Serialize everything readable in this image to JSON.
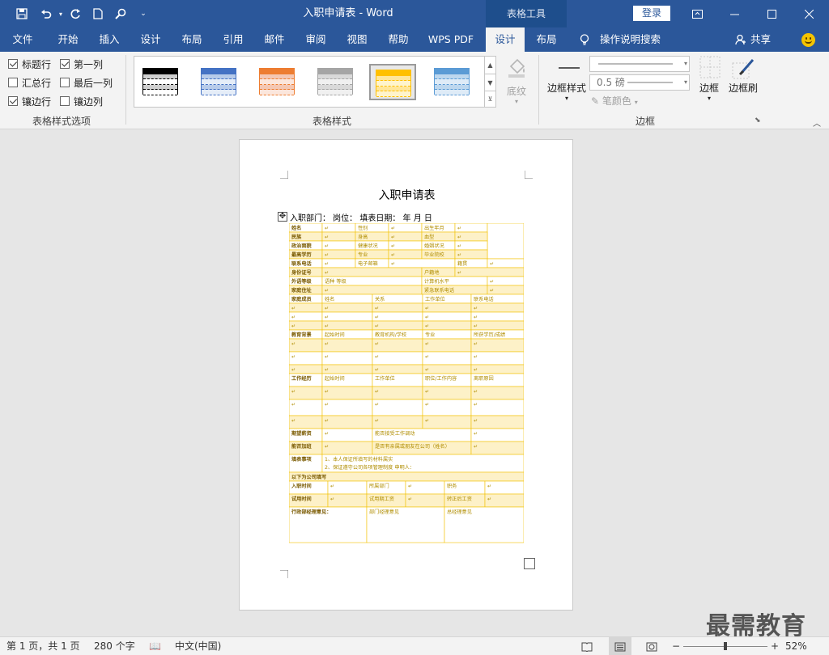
{
  "window": {
    "title": "入职申请表 - Word",
    "context_tab": "表格工具",
    "login": "登录"
  },
  "tabs": [
    "文件",
    "开始",
    "插入",
    "设计",
    "布局",
    "引用",
    "邮件",
    "审阅",
    "视图",
    "帮助",
    "WPS PDF",
    "设计",
    "布局"
  ],
  "active_tab_index": 11,
  "tell_me": "操作说明搜索",
  "share": "共享",
  "ribbon": {
    "style_options": {
      "label": "表格样式选项",
      "items": [
        {
          "label": "标题行",
          "checked": true
        },
        {
          "label": "第一列",
          "checked": true
        },
        {
          "label": "汇总行",
          "checked": false
        },
        {
          "label": "最后一列",
          "checked": false
        },
        {
          "label": "镶边行",
          "checked": true
        },
        {
          "label": "镶边列",
          "checked": false
        }
      ]
    },
    "table_styles": {
      "label": "表格样式",
      "swatches": [
        {
          "fill": "#ffffff",
          "band": "#cfcfcf",
          "line": "#000000"
        },
        {
          "fill": "#e5edf8",
          "band": "#b7cbea",
          "line": "#4472c4"
        },
        {
          "fill": "#fbe6dc",
          "band": "#f4c7b3",
          "line": "#ed7d31"
        },
        {
          "fill": "#f0f0f0",
          "band": "#d9d9d9",
          "line": "#a5a5a5"
        },
        {
          "fill": "#fff4cc",
          "band": "#ffe699",
          "line": "#ffc000"
        },
        {
          "fill": "#deebf7",
          "band": "#bdd7ee",
          "line": "#5b9bd5"
        }
      ],
      "selected_index": 4,
      "shading": "底纹"
    },
    "borders": {
      "label": "边框",
      "border_style": "边框样式",
      "weight": "0.5 磅",
      "pen_color": "笔颜色",
      "borders_btn": "边框",
      "painter": "边框刷"
    }
  },
  "document": {
    "title": "入职申请表",
    "meta": "入职部门：      岗位：      填表日期：      年       月       日",
    "table_accent": "#f2c200",
    "band_fill": "#fdf1c8",
    "rows": [
      {
        "h": 11,
        "cells": [
          [
            "姓名",
            0,
            41
          ],
          [
            "",
            41,
            41
          ],
          [
            "性别",
            82,
            41
          ],
          [
            "",
            123,
            41
          ],
          [
            "出生年月",
            164,
            41
          ],
          [
            "",
            205,
            40
          ]
        ],
        "photo": true
      },
      {
        "h": 11,
        "cells": [
          [
            "民族",
            0,
            41
          ],
          [
            "",
            41,
            41
          ],
          [
            "身高",
            82,
            41
          ],
          [
            "",
            123,
            41
          ],
          [
            "血型",
            164,
            41
          ],
          [
            "",
            205,
            40
          ]
        ]
      },
      {
        "h": 11,
        "cells": [
          [
            "政治面貌",
            0,
            41
          ],
          [
            "",
            41,
            41
          ],
          [
            "健康状况",
            82,
            41
          ],
          [
            "",
            123,
            41
          ],
          [
            "婚姻状况",
            164,
            41
          ],
          [
            "",
            205,
            40
          ]
        ]
      },
      {
        "h": 11,
        "cells": [
          [
            "最高学历",
            0,
            41
          ],
          [
            "",
            41,
            41
          ],
          [
            "专业",
            82,
            41
          ],
          [
            "",
            123,
            41
          ],
          [
            "毕业院校",
            164,
            41
          ],
          [
            "",
            205,
            40
          ]
        ]
      },
      {
        "h": 11,
        "cells": [
          [
            "联系电话",
            0,
            41
          ],
          [
            "",
            41,
            41
          ],
          [
            "电子邮箱",
            82,
            41
          ],
          [
            "",
            123,
            82
          ],
          [
            "籍贯",
            205,
            40
          ],
          [
            "",
            245,
            45
          ]
        ]
      },
      {
        "h": 11,
        "cells": [
          [
            "身份证号",
            0,
            41
          ],
          [
            "",
            41,
            123
          ],
          [
            "户籍地",
            164,
            41
          ],
          [
            "",
            205,
            85
          ]
        ]
      },
      {
        "h": 11,
        "cells": [
          [
            "外语等级",
            0,
            41
          ],
          [
            "语种    等级",
            41,
            123
          ],
          [
            "计算机水平",
            164,
            81
          ],
          [
            "",
            245,
            45
          ]
        ]
      },
      {
        "h": 11,
        "cells": [
          [
            "家庭住址",
            0,
            41
          ],
          [
            "",
            41,
            123
          ],
          [
            "紧急联系电话",
            164,
            81
          ],
          [
            "",
            245,
            45
          ]
        ]
      },
      {
        "h": 11,
        "cells": [
          [
            "家庭成员",
            0,
            41
          ],
          [
            "姓名",
            41,
            62
          ],
          [
            "关系",
            103,
            62
          ],
          [
            "工作单位",
            165,
            60
          ],
          [
            "联系电话",
            225,
            65
          ]
        ]
      },
      {
        "h": 11,
        "cells": [
          [
            "",
            0,
            41
          ],
          [
            "",
            41,
            62
          ],
          [
            "",
            103,
            62
          ],
          [
            "",
            165,
            60
          ],
          [
            "",
            225,
            65
          ]
        ]
      },
      {
        "h": 11,
        "cells": [
          [
            "",
            0,
            41
          ],
          [
            "",
            41,
            62
          ],
          [
            "",
            103,
            62
          ],
          [
            "",
            165,
            60
          ],
          [
            "",
            225,
            65
          ]
        ]
      },
      {
        "h": 11,
        "cells": [
          [
            "",
            0,
            41
          ],
          [
            "",
            41,
            62
          ],
          [
            "",
            103,
            62
          ],
          [
            "",
            165,
            60
          ],
          [
            "",
            225,
            65
          ]
        ]
      },
      {
        "h": 11,
        "cells": [
          [
            "教育背景",
            0,
            41
          ],
          [
            "起始时间",
            41,
            62
          ],
          [
            "教育机构/学校",
            103,
            62
          ],
          [
            "专业",
            165,
            60
          ],
          [
            "所获学历/成绩",
            225,
            65
          ]
        ]
      },
      {
        "h": 16,
        "cells": [
          [
            "",
            0,
            41
          ],
          [
            "",
            41,
            62
          ],
          [
            "",
            103,
            62
          ],
          [
            "",
            165,
            60
          ],
          [
            "",
            225,
            65
          ]
        ]
      },
      {
        "h": 16,
        "cells": [
          [
            "",
            0,
            41
          ],
          [
            "",
            41,
            62
          ],
          [
            "",
            103,
            62
          ],
          [
            "",
            165,
            60
          ],
          [
            "",
            225,
            65
          ]
        ]
      },
      {
        "h": 11,
        "cells": [
          [
            "",
            0,
            41
          ],
          [
            "",
            41,
            62
          ],
          [
            "",
            103,
            62
          ],
          [
            "",
            165,
            60
          ],
          [
            "",
            225,
            65
          ]
        ]
      },
      {
        "h": 16,
        "cells": [
          [
            "工作经历",
            0,
            41
          ],
          [
            "起始时间",
            41,
            62
          ],
          [
            "工作单位",
            103,
            62
          ],
          [
            "职位/工作内容",
            165,
            60
          ],
          [
            "离职原因",
            225,
            65
          ]
        ]
      },
      {
        "h": 16,
        "cells": [
          [
            "",
            0,
            41
          ],
          [
            "",
            41,
            62
          ],
          [
            "",
            103,
            62
          ],
          [
            "",
            165,
            60
          ],
          [
            "",
            225,
            65
          ]
        ]
      },
      {
        "h": 20,
        "cells": [
          [
            "",
            0,
            41
          ],
          [
            "",
            41,
            62
          ],
          [
            "",
            103,
            62
          ],
          [
            "",
            165,
            60
          ],
          [
            "",
            225,
            65
          ]
        ]
      },
      {
        "h": 16,
        "cells": [
          [
            "",
            0,
            41
          ],
          [
            "",
            41,
            62
          ],
          [
            "",
            103,
            62
          ],
          [
            "",
            165,
            60
          ],
          [
            "",
            225,
            65
          ]
        ]
      },
      {
        "h": 16,
        "cells": [
          [
            "期望薪资",
            0,
            41
          ],
          [
            "",
            41,
            62
          ],
          [
            "能否接受工作调动",
            103,
            122
          ],
          [
            "",
            225,
            65
          ]
        ]
      },
      {
        "h": 16,
        "cells": [
          [
            "能否加班",
            0,
            41
          ],
          [
            "",
            41,
            62
          ],
          [
            "是否有亲属或朋友在公司（姓名）",
            103,
            122
          ],
          [
            "",
            225,
            65
          ]
        ]
      },
      {
        "h": 22,
        "cells": [
          [
            "填表事项",
            0,
            41
          ],
          [
            "1、本人保证所填写的材料属实\n2、保证遵守公司各项管理制度         申明人：",
            41,
            249
          ]
        ]
      },
      {
        "h": 11,
        "cells": [
          [
            "以下为公司填写",
            0,
            290
          ]
        ]
      },
      {
        "h": 16,
        "cells": [
          [
            "入职时间",
            0,
            48
          ],
          [
            "",
            48,
            48
          ],
          [
            "所属部门",
            96,
            48
          ],
          [
            "",
            144,
            48
          ],
          [
            "职务",
            192,
            50
          ],
          [
            "",
            242,
            48
          ]
        ]
      },
      {
        "h": 16,
        "cells": [
          [
            "试用时间",
            0,
            48
          ],
          [
            "",
            48,
            48
          ],
          [
            "试用期工资",
            96,
            48
          ],
          [
            "",
            144,
            48
          ],
          [
            "转正后工资",
            192,
            50
          ],
          [
            "",
            242,
            48
          ]
        ]
      },
      {
        "h": 44,
        "cells": [
          [
            "行政部经理意见：",
            0,
            96
          ],
          [
            "部门经理意见",
            96,
            96
          ],
          [
            "总经理意见",
            192,
            98
          ]
        ]
      }
    ]
  },
  "status": {
    "page": "第 1 页，共 1 页",
    "words": "280 个字",
    "lang": "中文(中国)",
    "zoom": "52%",
    "zoom_level": 0.52
  },
  "watermark": "最需教育"
}
